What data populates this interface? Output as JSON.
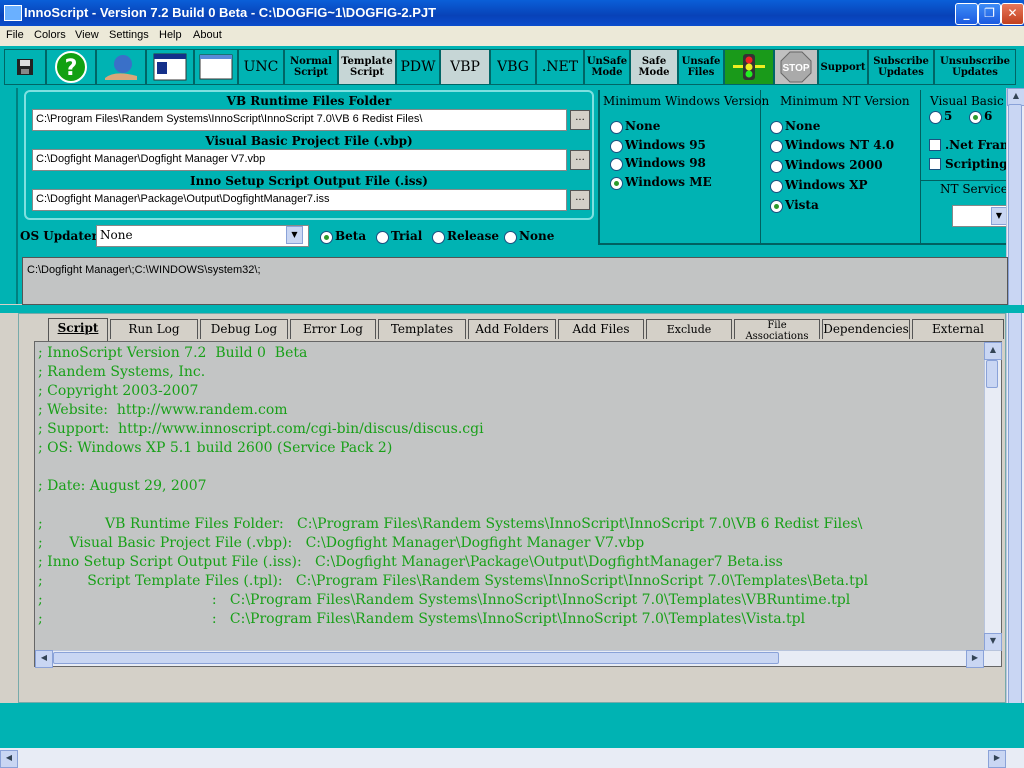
{
  "window": {
    "title": "InnoScript - Version 7.2  Build 0  Beta - C:\\DOGFIG~1\\DOGFIG-2.PJT"
  },
  "menu": [
    "File",
    "Colors",
    "View",
    "Settings",
    "Help",
    "About"
  ],
  "toolbar": {
    "unc": "UNC",
    "normal_script": "Normal\nScript",
    "template_script": "Template\nScript",
    "pdw": "PDW",
    "vbp": "VBP",
    "vbg": "VBG",
    "net": ".NET",
    "unsafe_mode": "UnSafe\nMode",
    "safe_mode": "Safe\nMode",
    "unsafe_files": "Unsafe\nFiles",
    "stop": "STOP",
    "support": "Support",
    "subscribe": "Subscribe\nUpdates",
    "unsubscribe": "Unsubscribe\nUpdates"
  },
  "files": {
    "vb_runtime_label": "VB Runtime Files Folder",
    "vb_runtime_value": "C:\\Program Files\\Randem Systems\\InnoScript\\InnoScript 7.0\\VB 6 Redist Files\\",
    "vbp_label": "Visual Basic Project File (.vbp)",
    "vbp_value": "C:\\Dogfight Manager\\Dogfight Manager V7.vbp",
    "iss_label": "Inno Setup Script Output File (.iss)",
    "iss_value": "C:\\Dogfight Manager\\Package\\Output\\DogfightManager7.iss",
    "browse": "..."
  },
  "os_updater": {
    "label": "OS Updater:",
    "value": "None",
    "options": [
      "Beta",
      "Trial",
      "Release",
      "None"
    ],
    "selected": "Beta"
  },
  "min_windows": {
    "title": "Minimum Windows Version",
    "options": [
      "None",
      "Windows 95",
      "Windows 98",
      "Windows ME"
    ],
    "selected": "Windows ME"
  },
  "min_nt": {
    "title": "Minimum NT Version",
    "options": [
      "None",
      "Windows NT 4.0",
      "Windows 2000",
      "Windows XP",
      "Vista"
    ],
    "selected": "Vista"
  },
  "vb_version": {
    "title": "Visual Basic V",
    "options": [
      "5",
      "6"
    ],
    "selected": "6",
    "net_framework": ".Net Framew",
    "scripting": "Scripting R",
    "nt_service": "NT Service"
  },
  "search_path": "C:\\Dogfight Manager\\;C:\\WINDOWS\\system32\\;",
  "tabs": [
    "Script",
    "Run Log",
    "Debug Log",
    "Error Log",
    "Templates",
    "Add Folders",
    "Add Files",
    "Exclude Folders",
    "File Associations",
    "Dependencies",
    "External Installs"
  ],
  "script_lines": [
    "; InnoScript Version 7.2  Build 0  Beta",
    "; Randem Systems, Inc.",
    "; Copyright 2003-2007",
    "; Website:  http://www.randem.com",
    "; Support:  http://www.innoscript.com/cgi-bin/discus/discus.cgi",
    "; OS: Windows XP 5.1 build 2600 (Service Pack 2)",
    "",
    "; Date: August 29, 2007",
    "",
    ";              VB Runtime Files Folder:   C:\\Program Files\\Randem Systems\\InnoScript\\InnoScript 7.0\\VB 6 Redist Files\\",
    ";      Visual Basic Project File (.vbp):   C:\\Dogfight Manager\\Dogfight Manager V7.vbp",
    "; Inno Setup Script Output File (.iss):   C:\\Dogfight Manager\\Package\\Output\\DogfightManager7 Beta.iss",
    ";          Script Template Files (.tpl):   C:\\Program Files\\Randem Systems\\InnoScript\\InnoScript 7.0\\Templates\\Beta.tpl",
    ";                                      :   C:\\Program Files\\Randem Systems\\InnoScript\\InnoScript 7.0\\Templates\\VBRuntime.tpl",
    ";                                      :   C:\\Program Files\\Randem Systems\\InnoScript\\InnoScript 7.0\\Templates\\Vista.tpl"
  ]
}
